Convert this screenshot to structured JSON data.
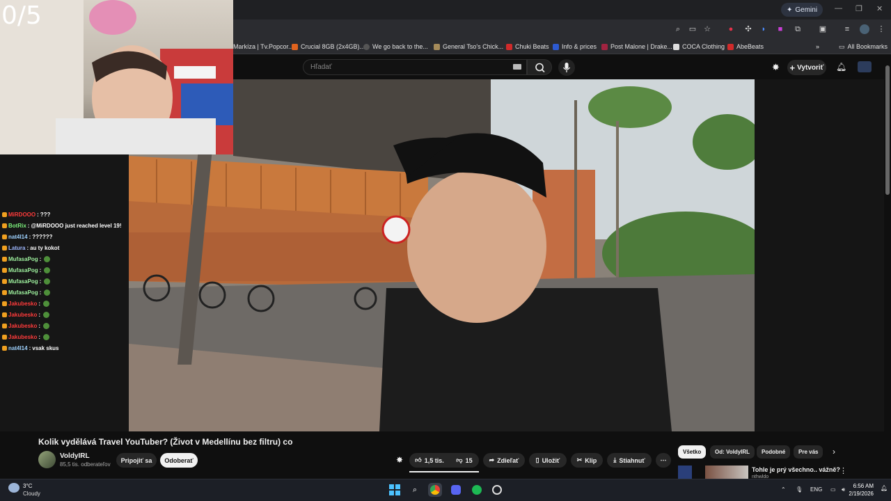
{
  "overlay": {
    "counter": "0/5"
  },
  "browser": {
    "gemini_label": "Gemini",
    "bookmarks": [
      "Markíza | Tv.Popcor...",
      "Crucial 8GB (2x4GB)...",
      "We go back to the...",
      "General Tso's Chick...",
      "Chuki Beats",
      "Info & prices",
      "Post Malone | Drake...",
      "COCA Clothing",
      "AbeBeats"
    ],
    "all_bookmarks": "All Bookmarks"
  },
  "youtube": {
    "search_placeholder": "Hľadať",
    "create_label": "Vytvoriť",
    "video_title": "Kolik vydělává Travel YouTuber? (Život v Medellínu bez filtru) co",
    "channel_name": "VoldyIRL",
    "channel_subs": "85,5 tis. odberateľov",
    "join_label": "Pripojiť sa",
    "subscribe_label": "Odoberať",
    "like_count": "1,5 tis.",
    "dislike_count": "15",
    "share_label": "Zdieľať",
    "save_label": "Uložiť",
    "clip_label": "Klip",
    "download_label": "Stiahnuť",
    "chips": [
      "Všetko",
      "Od: VoldyIRL",
      "Podobné",
      "Pre vás"
    ],
    "rec_title": "Tohle je prý všechno.. vážně?",
    "rec_channel": "nthwldo"
  },
  "chat": [
    {
      "user": "MiRDOOO",
      "text": "???",
      "color": "#ff3b3b"
    },
    {
      "user": "BotRix",
      "text": "@MiRDOOO just reached level 19!",
      "color": "#7df27d"
    },
    {
      "user": "nat4l14",
      "text": "??????",
      "color": "#9fd3ff"
    },
    {
      "user": "Latura",
      "text": "au ty kokot",
      "color": "#9fb8ff"
    },
    {
      "user": "MufasaPog",
      "text": "",
      "color": "#9ff29f"
    },
    {
      "user": "MufasaPog",
      "text": "",
      "color": "#9ff29f"
    },
    {
      "user": "MufasaPog",
      "text": "",
      "color": "#9ff29f"
    },
    {
      "user": "MufasaPog",
      "text": "",
      "color": "#9ff29f"
    },
    {
      "user": "Jakubesko",
      "text": "",
      "color": "#ff3b3b"
    },
    {
      "user": "Jakubesko",
      "text": "",
      "color": "#ff3b3b"
    },
    {
      "user": "Jakubesko",
      "text": "",
      "color": "#ff3b3b"
    },
    {
      "user": "Jakubesko",
      "text": "",
      "color": "#ff3b3b"
    },
    {
      "user": "nat4l14",
      "text": "vsak skus",
      "color": "#9fd3ff"
    }
  ],
  "taskbar": {
    "temp": "3°C",
    "weather": "Cloudy",
    "lang": "ENG",
    "time": "6:56 AM",
    "date": "2/19/2026"
  }
}
